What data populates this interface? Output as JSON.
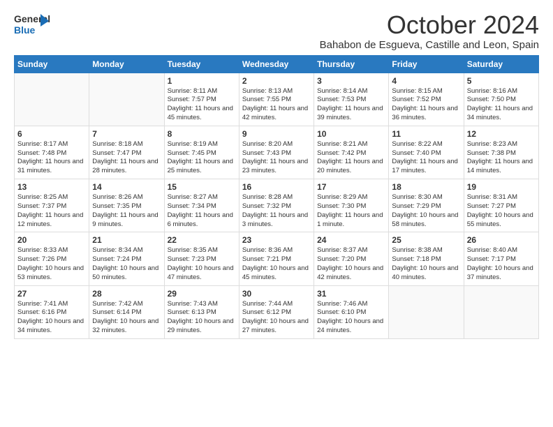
{
  "logo": {
    "general": "General",
    "blue": "Blue"
  },
  "header": {
    "month": "October 2024",
    "location": "Bahabon de Esgueva, Castille and Leon, Spain"
  },
  "weekdays": [
    "Sunday",
    "Monday",
    "Tuesday",
    "Wednesday",
    "Thursday",
    "Friday",
    "Saturday"
  ],
  "weeks": [
    [
      {
        "day": "",
        "info": ""
      },
      {
        "day": "",
        "info": ""
      },
      {
        "day": "1",
        "info": "Sunrise: 8:11 AM\nSunset: 7:57 PM\nDaylight: 11 hours and 45 minutes."
      },
      {
        "day": "2",
        "info": "Sunrise: 8:13 AM\nSunset: 7:55 PM\nDaylight: 11 hours and 42 minutes."
      },
      {
        "day": "3",
        "info": "Sunrise: 8:14 AM\nSunset: 7:53 PM\nDaylight: 11 hours and 39 minutes."
      },
      {
        "day": "4",
        "info": "Sunrise: 8:15 AM\nSunset: 7:52 PM\nDaylight: 11 hours and 36 minutes."
      },
      {
        "day": "5",
        "info": "Sunrise: 8:16 AM\nSunset: 7:50 PM\nDaylight: 11 hours and 34 minutes."
      }
    ],
    [
      {
        "day": "6",
        "info": "Sunrise: 8:17 AM\nSunset: 7:48 PM\nDaylight: 11 hours and 31 minutes."
      },
      {
        "day": "7",
        "info": "Sunrise: 8:18 AM\nSunset: 7:47 PM\nDaylight: 11 hours and 28 minutes."
      },
      {
        "day": "8",
        "info": "Sunrise: 8:19 AM\nSunset: 7:45 PM\nDaylight: 11 hours and 25 minutes."
      },
      {
        "day": "9",
        "info": "Sunrise: 8:20 AM\nSunset: 7:43 PM\nDaylight: 11 hours and 23 minutes."
      },
      {
        "day": "10",
        "info": "Sunrise: 8:21 AM\nSunset: 7:42 PM\nDaylight: 11 hours and 20 minutes."
      },
      {
        "day": "11",
        "info": "Sunrise: 8:22 AM\nSunset: 7:40 PM\nDaylight: 11 hours and 17 minutes."
      },
      {
        "day": "12",
        "info": "Sunrise: 8:23 AM\nSunset: 7:38 PM\nDaylight: 11 hours and 14 minutes."
      }
    ],
    [
      {
        "day": "13",
        "info": "Sunrise: 8:25 AM\nSunset: 7:37 PM\nDaylight: 11 hours and 12 minutes."
      },
      {
        "day": "14",
        "info": "Sunrise: 8:26 AM\nSunset: 7:35 PM\nDaylight: 11 hours and 9 minutes."
      },
      {
        "day": "15",
        "info": "Sunrise: 8:27 AM\nSunset: 7:34 PM\nDaylight: 11 hours and 6 minutes."
      },
      {
        "day": "16",
        "info": "Sunrise: 8:28 AM\nSunset: 7:32 PM\nDaylight: 11 hours and 3 minutes."
      },
      {
        "day": "17",
        "info": "Sunrise: 8:29 AM\nSunset: 7:30 PM\nDaylight: 11 hours and 1 minute."
      },
      {
        "day": "18",
        "info": "Sunrise: 8:30 AM\nSunset: 7:29 PM\nDaylight: 10 hours and 58 minutes."
      },
      {
        "day": "19",
        "info": "Sunrise: 8:31 AM\nSunset: 7:27 PM\nDaylight: 10 hours and 55 minutes."
      }
    ],
    [
      {
        "day": "20",
        "info": "Sunrise: 8:33 AM\nSunset: 7:26 PM\nDaylight: 10 hours and 53 minutes."
      },
      {
        "day": "21",
        "info": "Sunrise: 8:34 AM\nSunset: 7:24 PM\nDaylight: 10 hours and 50 minutes."
      },
      {
        "day": "22",
        "info": "Sunrise: 8:35 AM\nSunset: 7:23 PM\nDaylight: 10 hours and 47 minutes."
      },
      {
        "day": "23",
        "info": "Sunrise: 8:36 AM\nSunset: 7:21 PM\nDaylight: 10 hours and 45 minutes."
      },
      {
        "day": "24",
        "info": "Sunrise: 8:37 AM\nSunset: 7:20 PM\nDaylight: 10 hours and 42 minutes."
      },
      {
        "day": "25",
        "info": "Sunrise: 8:38 AM\nSunset: 7:18 PM\nDaylight: 10 hours and 40 minutes."
      },
      {
        "day": "26",
        "info": "Sunrise: 8:40 AM\nSunset: 7:17 PM\nDaylight: 10 hours and 37 minutes."
      }
    ],
    [
      {
        "day": "27",
        "info": "Sunrise: 7:41 AM\nSunset: 6:16 PM\nDaylight: 10 hours and 34 minutes."
      },
      {
        "day": "28",
        "info": "Sunrise: 7:42 AM\nSunset: 6:14 PM\nDaylight: 10 hours and 32 minutes."
      },
      {
        "day": "29",
        "info": "Sunrise: 7:43 AM\nSunset: 6:13 PM\nDaylight: 10 hours and 29 minutes."
      },
      {
        "day": "30",
        "info": "Sunrise: 7:44 AM\nSunset: 6:12 PM\nDaylight: 10 hours and 27 minutes."
      },
      {
        "day": "31",
        "info": "Sunrise: 7:46 AM\nSunset: 6:10 PM\nDaylight: 10 hours and 24 minutes."
      },
      {
        "day": "",
        "info": ""
      },
      {
        "day": "",
        "info": ""
      }
    ]
  ]
}
